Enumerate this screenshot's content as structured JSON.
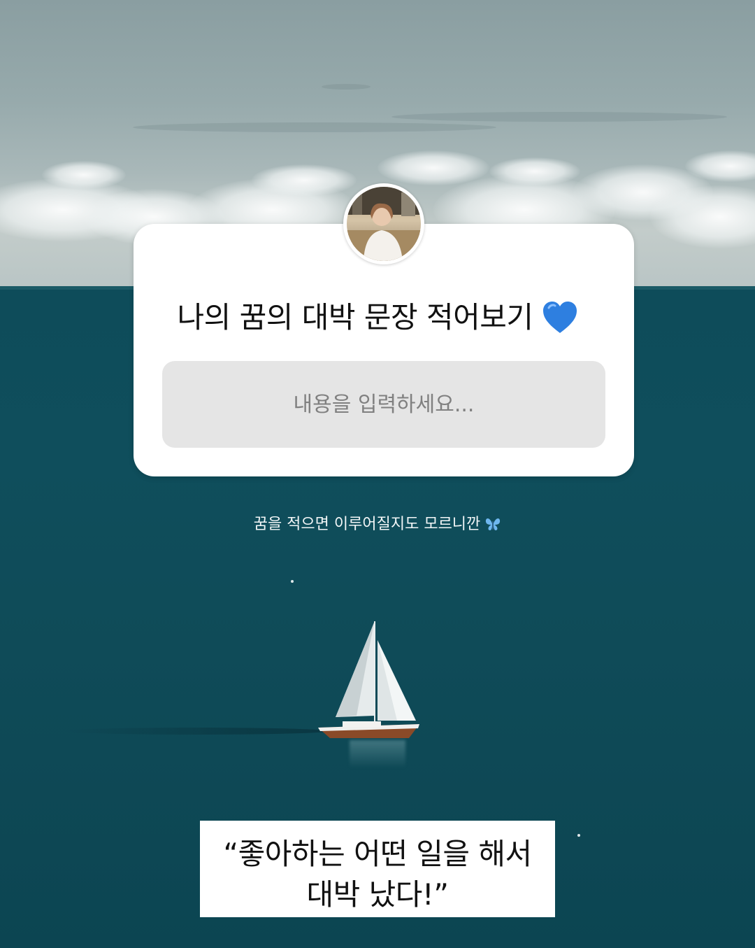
{
  "question_sticker": {
    "title": "나의 꿈의 대박 문장 적어보기",
    "title_icon": "blue-heart-icon",
    "input_placeholder": "내용을 입력하세요...",
    "avatar": "profile-photo"
  },
  "caption": {
    "text": "꿈을 적으면 이루어질지도 모르니깐",
    "icon": "butterfly-icon"
  },
  "answer": {
    "line1": "“좋아하는 어떤 일을 해서",
    "line2": "대박 났다!”"
  },
  "colors": {
    "sea": "#0f4a57",
    "sky": "#9aabad",
    "card": "#ffffff",
    "input": "#e5e5e5",
    "heart": "#2e7fe0",
    "butterfly": "#6fb7ef"
  }
}
